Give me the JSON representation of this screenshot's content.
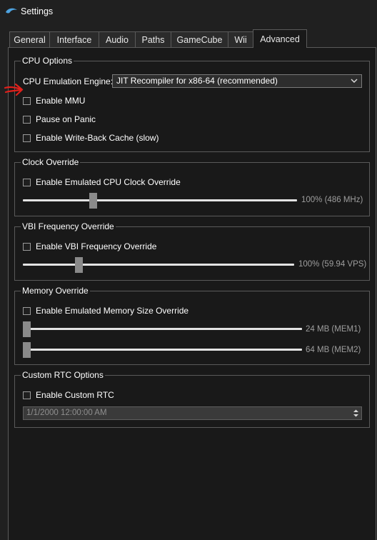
{
  "window": {
    "title": "Settings",
    "icon": "dolphin-icon"
  },
  "tabs": [
    {
      "label": "General"
    },
    {
      "label": "Interface"
    },
    {
      "label": "Audio"
    },
    {
      "label": "Paths"
    },
    {
      "label": "GameCube"
    },
    {
      "label": "Wii"
    },
    {
      "label": "Advanced",
      "active": true
    }
  ],
  "cpu_options": {
    "title": "CPU Options",
    "engine_label": "CPU Emulation Engine:",
    "engine_value": "JIT Recompiler for x86-64 (recommended)",
    "enable_mmu": {
      "label": "Enable MMU",
      "checked": false
    },
    "pause_on_panic": {
      "label": "Pause on Panic",
      "checked": false
    },
    "write_back_cache": {
      "label": "Enable Write-Back Cache (slow)",
      "checked": false
    }
  },
  "clock_override": {
    "title": "Clock Override",
    "checkbox": {
      "label": "Enable Emulated CPU Clock Override",
      "checked": false
    },
    "slider_value": "100% (486 MHz)",
    "slider_percent": 100
  },
  "vbi_override": {
    "title": "VBI Frequency Override",
    "checkbox": {
      "label": "Enable VBI Frequency Override",
      "checked": false
    },
    "slider_value": "100% (59.94 VPS)",
    "slider_percent": 100
  },
  "memory_override": {
    "title": "Memory Override",
    "checkbox": {
      "label": "Enable Emulated Memory Size Override",
      "checked": false
    },
    "mem1_value": "24 MB (MEM1)",
    "mem2_value": "64 MB (MEM2)"
  },
  "custom_rtc": {
    "title": "Custom RTC Options",
    "checkbox": {
      "label": "Enable Custom RTC",
      "checked": false
    },
    "datetime_value": "1/1/2000 12:00:00 AM"
  },
  "colors": {
    "background": "#191919",
    "border": "#5a5a5a",
    "slider_thumb": "#8a8a8a",
    "annotation_arrow": "#e0201b"
  }
}
